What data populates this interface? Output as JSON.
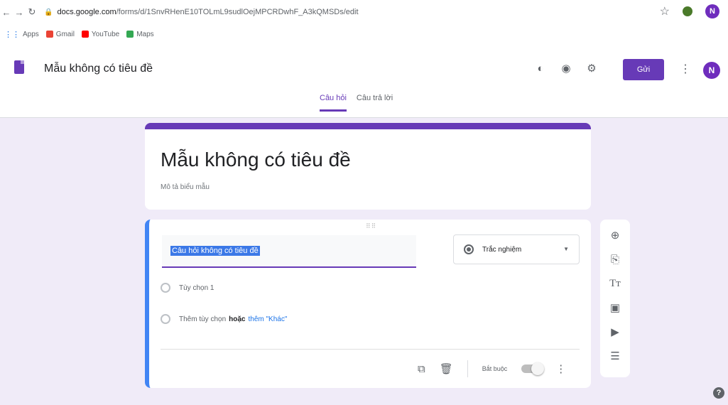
{
  "browser": {
    "url_host": "docs.google.com",
    "url_path": "/forms/d/1SnvRHenE10TOLmL9sudlOejMPCRDwhF_A3kQMSDs/edit",
    "bookmarks": [
      "Apps",
      "Gmail",
      "YouTube",
      "Maps"
    ],
    "profile_initial": "N"
  },
  "header": {
    "form_name": "Mẫu không có tiêu đề",
    "send_label": "Gửi",
    "profile_initial": "N",
    "icons": [
      "palette-icon",
      "preview-eye-icon",
      "settings-gear-icon"
    ],
    "tabs": [
      {
        "label": "Câu hỏi",
        "active": true
      },
      {
        "label": "Câu trả lời",
        "active": false
      }
    ]
  },
  "title_card": {
    "title": "Mẫu không có tiêu đề",
    "description": "Mô tả biểu mẫu"
  },
  "question": {
    "title": "Câu hỏi không có tiêu đề",
    "type": "Trắc nghiệm",
    "option1": "Tùy chọn 1",
    "add_option": "Thêm tùy chọn",
    "or": "hoặc",
    "add_other": "thêm \"Khác\"",
    "required_label": "Bắt buộc"
  },
  "colors": {
    "accent": "#673ab7",
    "active_border": "#4285f4",
    "background": "#f0ebf8"
  }
}
